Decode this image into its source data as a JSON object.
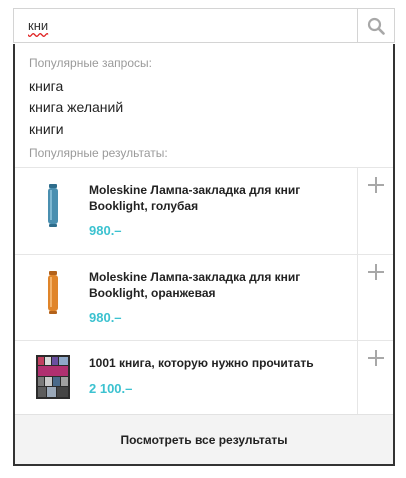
{
  "search": {
    "value": "кни",
    "placeholder": ""
  },
  "dropdown": {
    "popular_queries_label": "Популярные запросы:",
    "popular_queries": [
      "книга",
      "книга желаний",
      "книги"
    ],
    "popular_results_label": "Популярные результаты:",
    "products": [
      {
        "title": "Moleskine Лампа-закладка для книг Booklight, голубая",
        "price": "980.–",
        "thumb_color": "#4a8fb0"
      },
      {
        "title": "Moleskine Лампа-закладка для книг Booklight, оранжевая",
        "price": "980.–",
        "thumb_color": "#e0852a"
      },
      {
        "title": "1001 книга, которую нужно прочитать",
        "price": "2 100.–",
        "thumb_color": "#b03070"
      }
    ],
    "view_all_label": "Посмотреть все результаты"
  },
  "colors": {
    "price": "#3cc2d0",
    "border_dark": "#333333"
  },
  "icons": {
    "search": "search-icon",
    "add": "plus-icon"
  }
}
